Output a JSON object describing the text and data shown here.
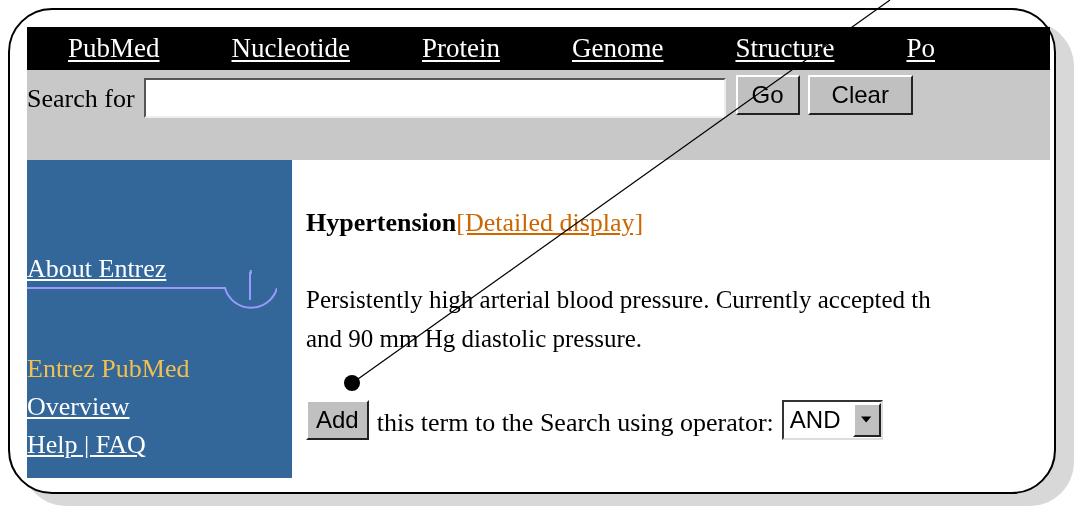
{
  "nav": [
    {
      "label": "PubMed"
    },
    {
      "label": "Nucleotide"
    },
    {
      "label": "Protein"
    },
    {
      "label": "Genome"
    },
    {
      "label": "Structure"
    },
    {
      "label": "Po"
    }
  ],
  "search": {
    "label": "Search for",
    "buttons": [
      "Go",
      "Clear"
    ]
  },
  "sidebar": {
    "items": [
      {
        "kind": "link",
        "label": "About Entrez"
      },
      {
        "kind": "divider"
      },
      {
        "kind": "heading",
        "label": "Entrez PubMed"
      },
      {
        "kind": "link",
        "label": "Overview"
      },
      {
        "kind": "link",
        "label": "Help | FAQ"
      }
    ]
  },
  "content": {
    "term": "Hypertension",
    "detail_link": "[Detailed display]",
    "definition": "Persistently high arterial blood pressure. Currently accepted th\nand 90 mm Hg diastolic pressure.",
    "add_button": "Add",
    "operator_label": "this term to the Search using operator:",
    "operator": {
      "value": "AND"
    }
  }
}
